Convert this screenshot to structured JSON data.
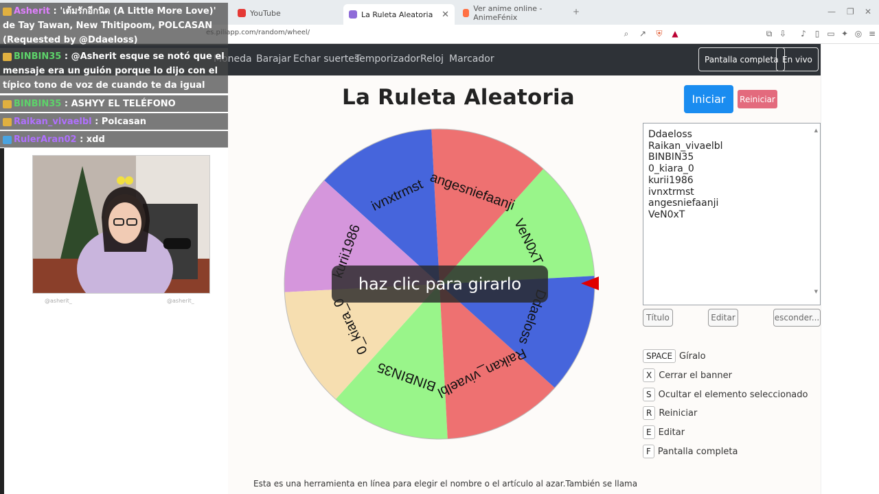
{
  "browser": {
    "tabs": [
      {
        "label": "YouTube",
        "color": "#e53935"
      },
      {
        "label": "La Ruleta Aleatoria",
        "color": "#8e6bd8"
      },
      {
        "label": "Ver anime online - AnimeFénix",
        "color": "#ff7043"
      }
    ],
    "url": "es.piliapp.com/random/wheel/"
  },
  "nav": {
    "items": [
      "Moneda",
      "Barajar",
      "Echar suertes",
      "Temporizador",
      "Reloj",
      "Marcador"
    ],
    "fullscreen": "Pantalla completa",
    "live": "En vivo"
  },
  "page": {
    "title": "La Ruleta Aleatoria",
    "start": "Iniciar",
    "reset": "Reiniciar",
    "entries": [
      "Ddaeloss",
      "Raikan_vivaelbl",
      "BINBIN35",
      "0_kiara_0",
      "kurii1986",
      "ivnxtrmst",
      "angesniefaanji",
      "VeN0xT"
    ],
    "buttons": {
      "title": "Título",
      "edit": "Editar",
      "hide": "esconder..."
    },
    "shortcuts": [
      {
        "key": "SPACE",
        "label": "Gíralo"
      },
      {
        "key": "X",
        "label": "Cerrar el banner"
      },
      {
        "key": "S",
        "label": "Ocultar el elemento seleccionado"
      },
      {
        "key": "R",
        "label": "Reiniciar"
      },
      {
        "key": "E",
        "label": "Editar"
      },
      {
        "key": "F",
        "label": "Pantalla completa"
      }
    ],
    "footer": "Esta es una herramienta en línea para elegir el nombre o el artículo al azar.También se llama"
  },
  "wheel": {
    "overlay": "haz clic para girarlo",
    "segments": [
      {
        "label": "VeN0xT",
        "color": "#99f58a"
      },
      {
        "label": "angesniefaanji",
        "color": "#ee7171"
      },
      {
        "label": "ivnxtrmst",
        "color": "#4665dc"
      },
      {
        "label": "kurii1986",
        "color": "#d596dc"
      },
      {
        "label": "0_kiara_0",
        "color": "#f6deb0"
      },
      {
        "label": "BINBIN35",
        "color": "#99f58a"
      },
      {
        "label": "Raikan_vivaelbl",
        "color": "#ee7171"
      },
      {
        "label": "Ddaeloss",
        "color": "#4665dc"
      }
    ],
    "pointer_color": "#e00000"
  },
  "chat": {
    "messages": [
      {
        "user": "Asherit",
        "user_color": "#e080ff",
        "text": " : 'เต้มรักอีกนิด (A Little More Love)' de Tay Tawan, New Thitipoom, POLCASAN (Requested by @Ddaeloss)"
      },
      {
        "user": "BINBIN35",
        "user_color": "#5dd36a",
        "text": " : @Asherit esque se notó que el mensaje era un guión porque lo dijo con el típico tono de voz de cuando te da igual algo"
      },
      {
        "user": "BINBIN35",
        "user_color": "#5dd36a",
        "text": " : ASHYY EL TELÉFONO"
      },
      {
        "user": "Raikan_vivaelbl",
        "user_color": "#b070ff",
        "text": " : Polcasan"
      },
      {
        "user": "RulerAran02",
        "user_color": "#b070ff",
        "text": " : xdd"
      }
    ],
    "cam_labels": [
      "@asherit_",
      "@asherit_"
    ]
  }
}
